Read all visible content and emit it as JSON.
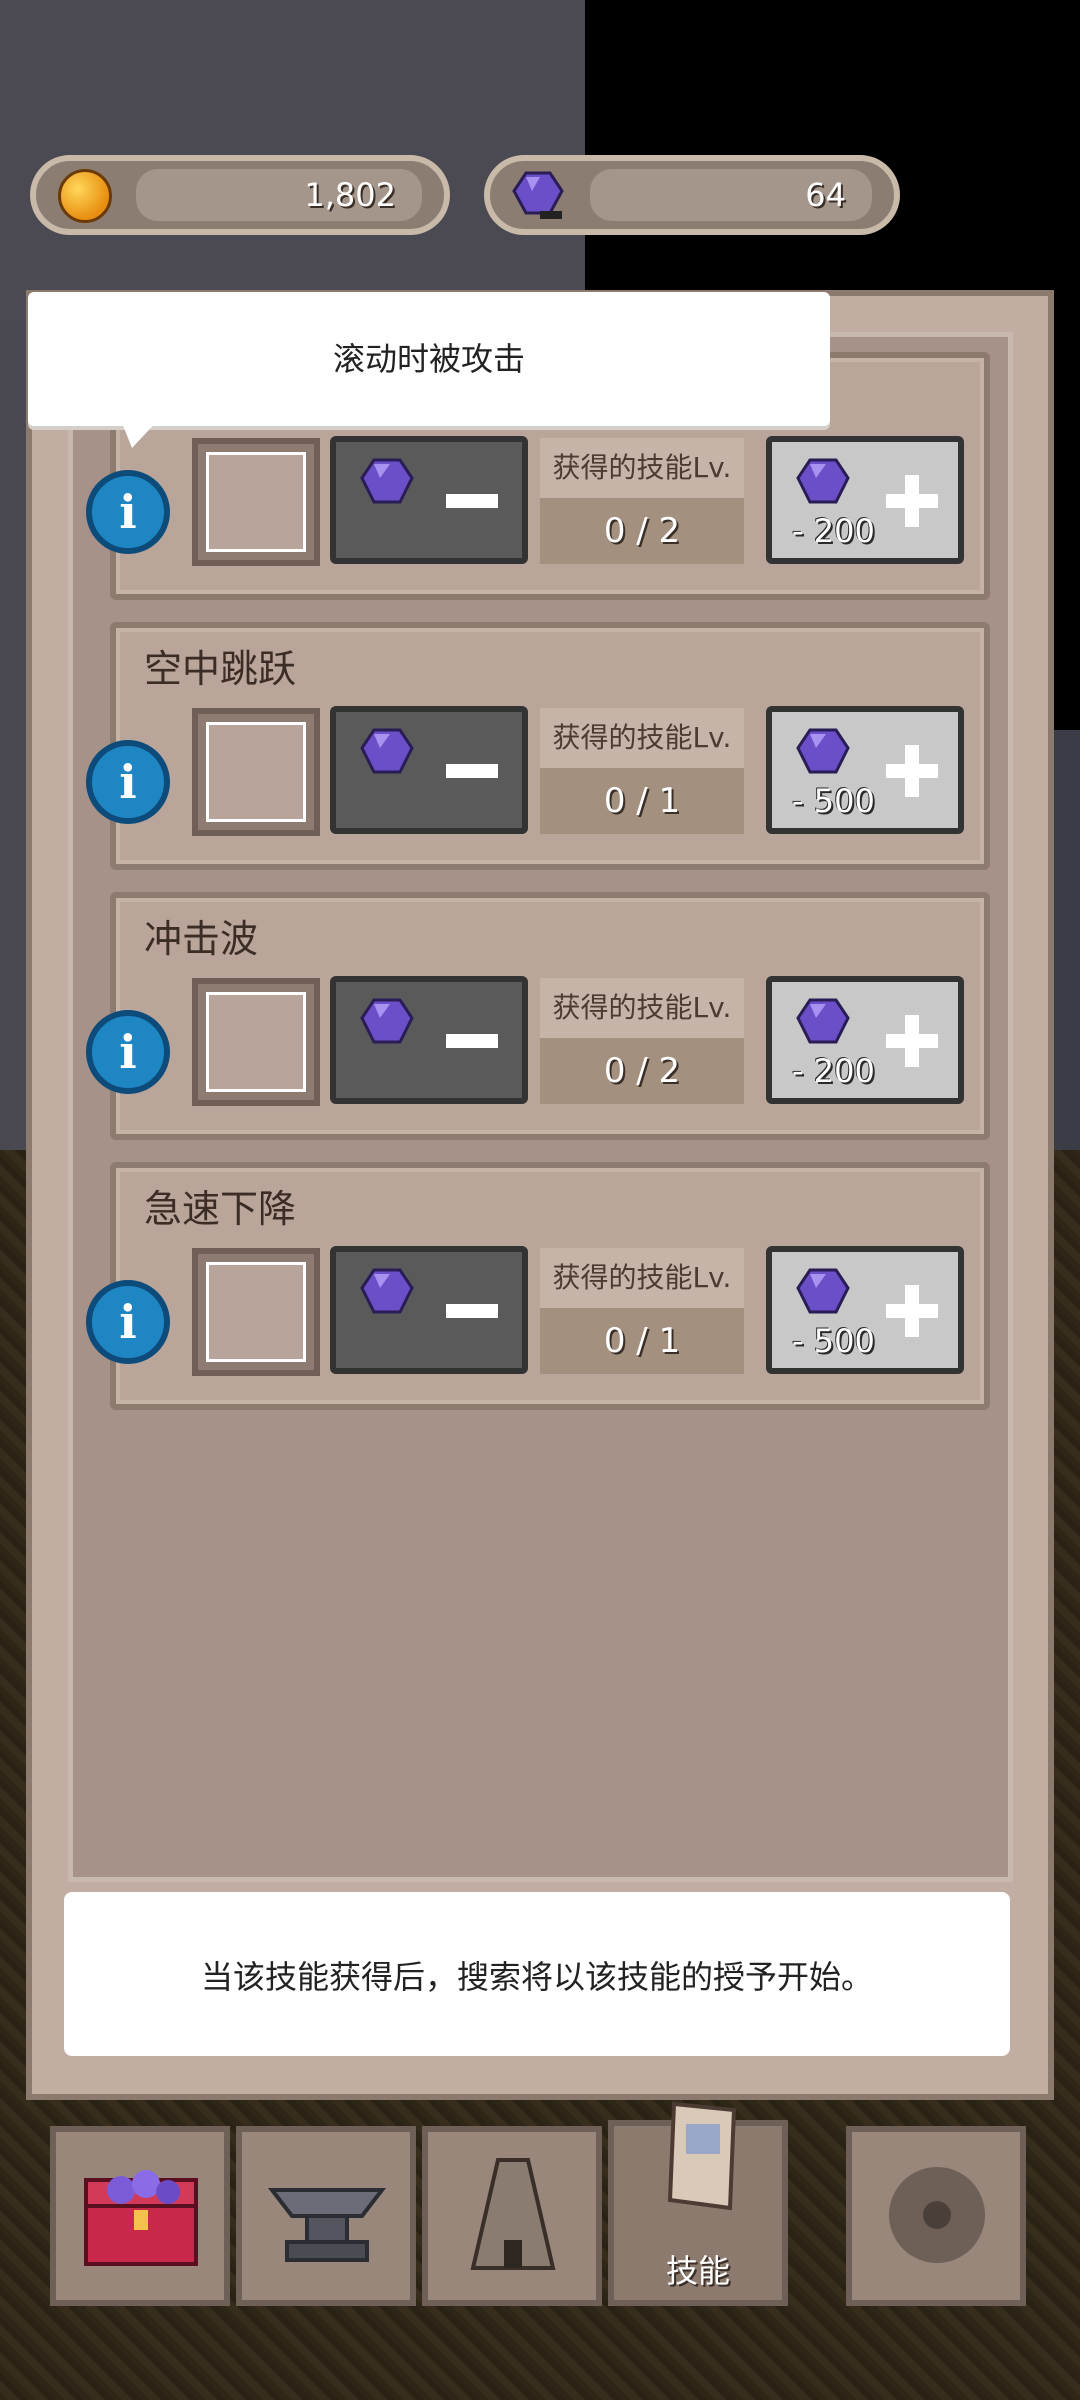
{
  "currencies": {
    "gold": {
      "value": "1,802",
      "icon": "gold-coin-icon"
    },
    "gems": {
      "value": "64",
      "icon": "purple-gem-icon"
    }
  },
  "tooltip": {
    "text": "滚动时被攻击"
  },
  "skills": [
    {
      "title": "",
      "level_label": "获得的技能Lv.",
      "level": "0 / 2",
      "cost": "- 200",
      "icon": "roll-skill-icon"
    },
    {
      "title": "空中跳跃",
      "level_label": "获得的技能Lv.",
      "level": "0 / 1",
      "cost": "- 500",
      "icon": "air-jump-skill-icon"
    },
    {
      "title": "冲击波",
      "level_label": "获得的技能Lv.",
      "level": "0 / 2",
      "cost": "- 200",
      "icon": "shockwave-skill-icon"
    },
    {
      "title": "急速下降",
      "level_label": "获得的技能Lv.",
      "level": "0 / 1",
      "cost": "- 500",
      "icon": "rapid-descent-skill-icon"
    }
  ],
  "footer_message": "当该技能获得后，搜索将以该技能的授予开始。",
  "nav": [
    {
      "label": "",
      "icon": "treasure-chest-icon"
    },
    {
      "label": "",
      "icon": "anvil-icon"
    },
    {
      "label": "",
      "icon": "tower-icon"
    },
    {
      "label": "技能",
      "icon": "skill-scroll-icon",
      "active": true
    },
    {
      "label": "",
      "icon": "gear-icon"
    }
  ],
  "colors": {
    "gem": "#6b4fc8",
    "info": "#1f86c4",
    "panel": "#c1ada2"
  }
}
